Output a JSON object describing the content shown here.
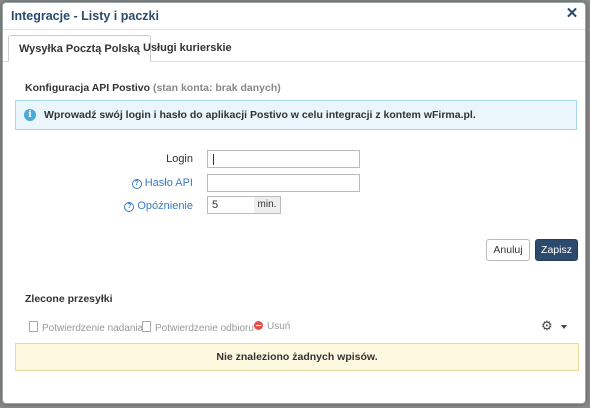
{
  "window": {
    "title": "Integracje - Listy i paczki"
  },
  "tabs": [
    {
      "label": "Wysyłka Pocztą Polską",
      "active": true
    },
    {
      "label": "Usługi kurierskie",
      "active": false
    }
  ],
  "config": {
    "title": "Konfiguracja API Postivo",
    "status": "(stan konta: brak danych)",
    "info": "Wprowadź swój login i hasło do aplikacji Postivo w celu integracji z kontem wFirma.pl."
  },
  "form": {
    "login_label": "Login",
    "login_value": "",
    "password_label": "Hasło API",
    "password_value": "",
    "delay_label": "Opóźnienie",
    "delay_value": "5",
    "delay_unit": "min."
  },
  "buttons": {
    "cancel": "Anuluj",
    "save": "Zapisz"
  },
  "orders": {
    "title": "Zlecone przesyłki",
    "actions": [
      "Potwierdzenie nadania",
      "Potwierdzenie odbioru",
      "Usuń"
    ],
    "empty": "Nie znaleziono żadnych wpisów."
  },
  "colors": {
    "accent": "#2c4a6b",
    "link": "#3a7cc0",
    "info_bg": "#eaf6fb",
    "warning_bg": "#fcf8e0",
    "delete": "#e0534a"
  }
}
